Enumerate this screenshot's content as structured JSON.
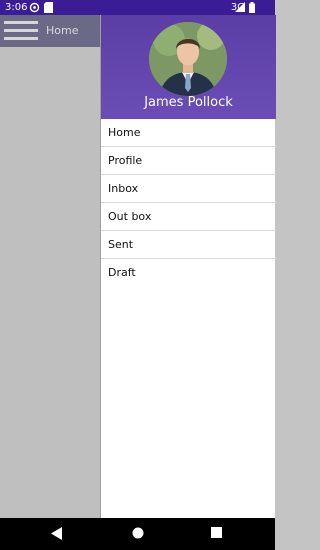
{
  "status_bar": {
    "time": "3:06",
    "network": "3G",
    "icons": [
      "sync-icon",
      "sd-card-icon",
      "signal-icon",
      "battery-icon"
    ],
    "background": "#3a1d94"
  },
  "app_bar": {
    "title": "Home",
    "menu_icon": "hamburger-icon"
  },
  "drawer": {
    "header_color": "#5b3ea5",
    "user_name": "James Pollock",
    "items": [
      {
        "label": "Home"
      },
      {
        "label": "Profile"
      },
      {
        "label": "Inbox"
      },
      {
        "label": "Out box"
      },
      {
        "label": "Sent"
      },
      {
        "label": "Draft"
      }
    ]
  },
  "nav_bar": {
    "buttons": [
      "back-icon",
      "home-icon",
      "recents-icon"
    ]
  }
}
